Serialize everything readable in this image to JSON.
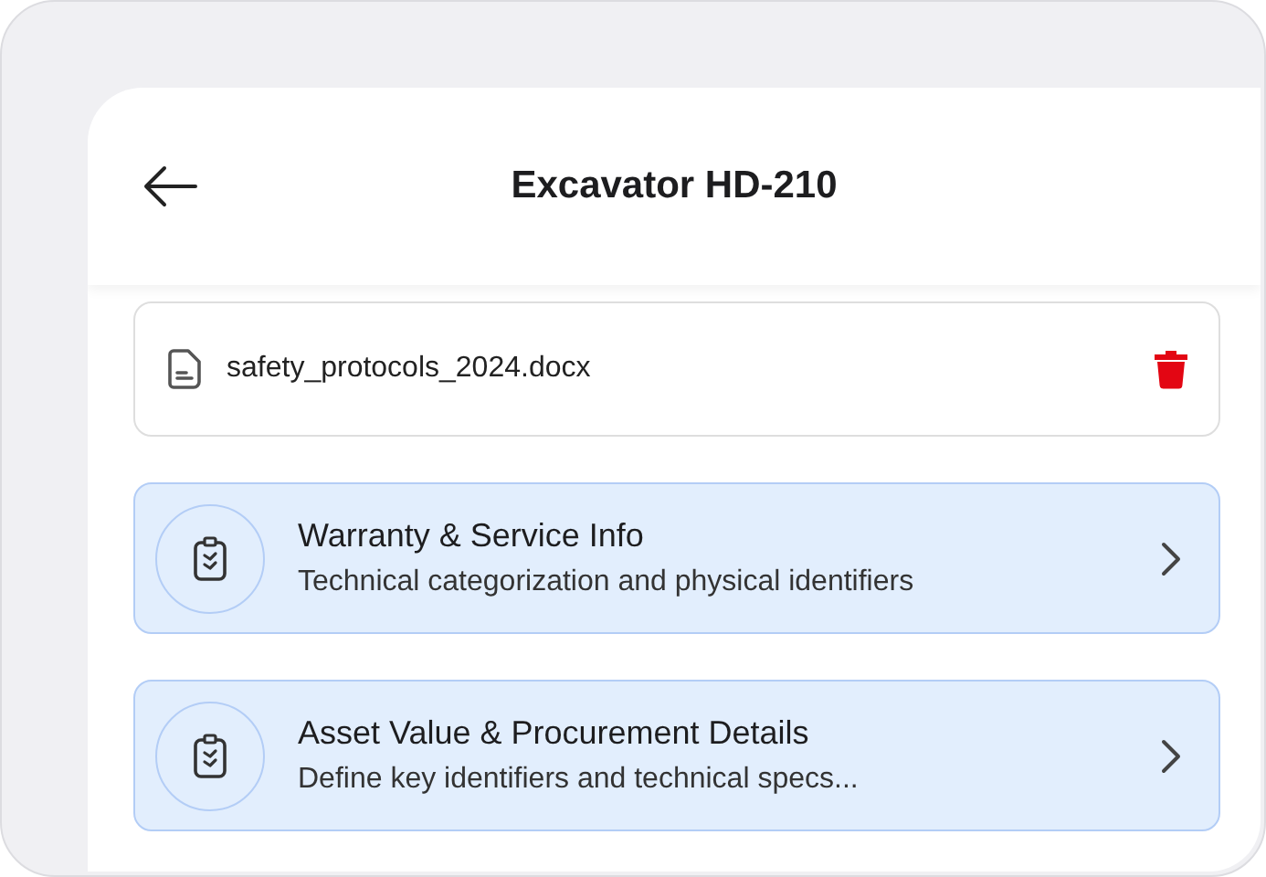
{
  "header": {
    "title": "Excavator HD-210"
  },
  "attachment": {
    "filename": "safety_protocols_2024.docx"
  },
  "sections": [
    {
      "title": "Warranty & Service Info",
      "subtitle": "Technical categorization and physical identifiers"
    },
    {
      "title": "Asset Value & Procurement Details",
      "subtitle": "Define key identifiers and technical specs..."
    }
  ]
}
